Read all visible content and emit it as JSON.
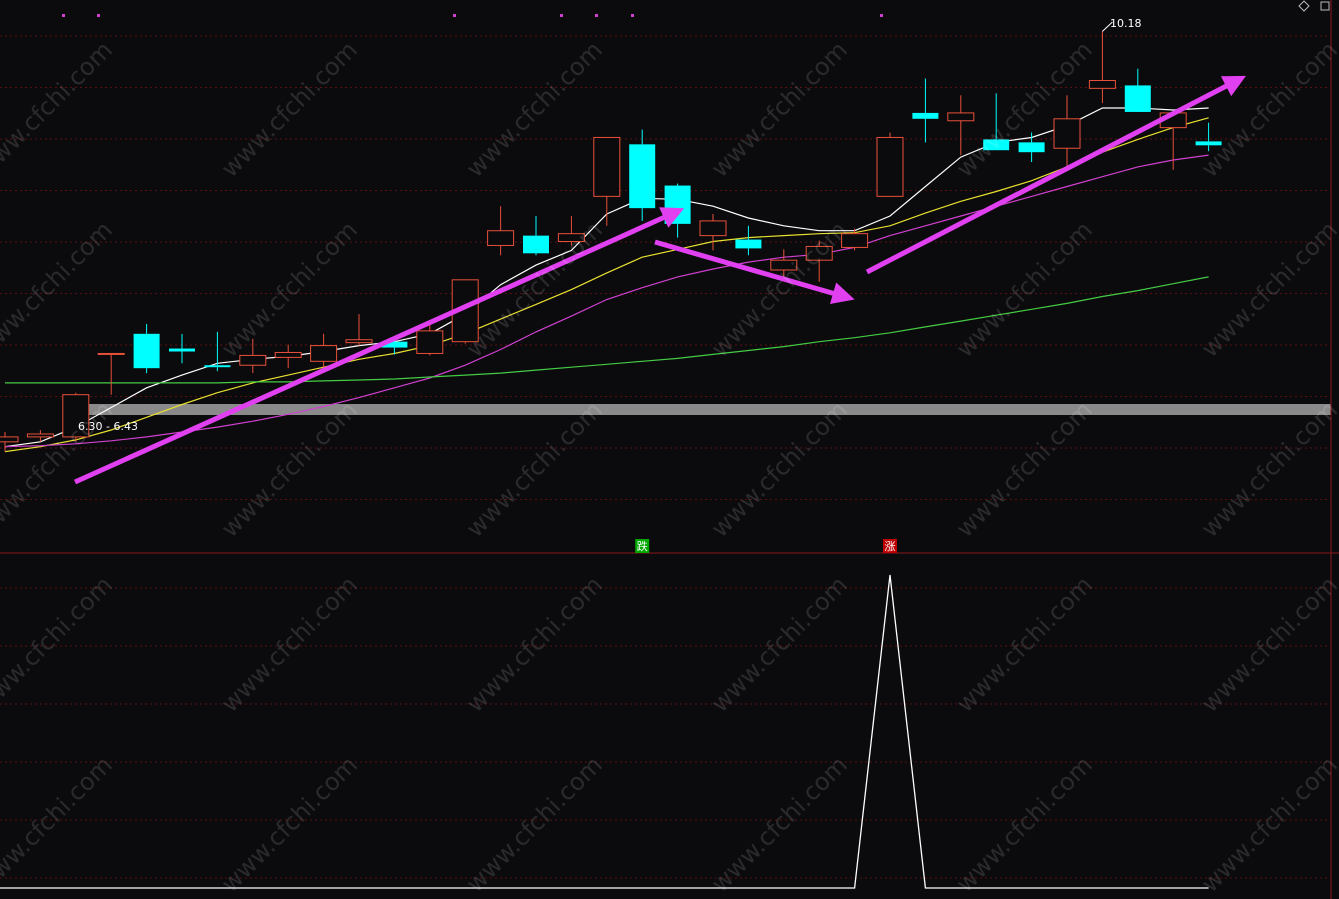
{
  "chart_data": {
    "type": "candlestick",
    "price_range": [
      5.0,
      10.5
    ],
    "candles": [
      {
        "o": 6.0,
        "h": 6.1,
        "l": 5.9,
        "c": 6.05
      },
      {
        "o": 6.05,
        "h": 6.12,
        "l": 6.0,
        "c": 6.08
      },
      {
        "o": 6.05,
        "h": 6.5,
        "l": 6.0,
        "c": 6.48
      },
      {
        "o": 6.9,
        "h": 6.9,
        "l": 6.48,
        "c": 6.9
      },
      {
        "o": 7.1,
        "h": 7.2,
        "l": 6.7,
        "c": 6.75
      },
      {
        "o": 6.95,
        "h": 7.1,
        "l": 6.8,
        "c": 6.92
      },
      {
        "o": 6.78,
        "h": 7.12,
        "l": 6.72,
        "c": 6.76
      },
      {
        "o": 6.78,
        "h": 7.05,
        "l": 6.7,
        "c": 6.88
      },
      {
        "o": 6.86,
        "h": 6.99,
        "l": 6.75,
        "c": 6.91
      },
      {
        "o": 6.82,
        "h": 7.1,
        "l": 6.75,
        "c": 6.98
      },
      {
        "o": 7.01,
        "h": 7.3,
        "l": 6.98,
        "c": 7.04
      },
      {
        "o": 7.02,
        "h": 7.05,
        "l": 6.89,
        "c": 6.96
      },
      {
        "o": 6.9,
        "h": 7.2,
        "l": 6.88,
        "c": 7.13
      },
      {
        "o": 7.02,
        "h": 7.51,
        "l": 7.0,
        "c": 7.65
      },
      {
        "o": 8.0,
        "h": 8.4,
        "l": 7.9,
        "c": 8.15
      },
      {
        "o": 8.1,
        "h": 8.3,
        "l": 7.9,
        "c": 7.92
      },
      {
        "o": 8.04,
        "h": 8.3,
        "l": 8.0,
        "c": 8.12
      },
      {
        "o": 8.5,
        "h": 8.9,
        "l": 8.2,
        "c": 9.1
      },
      {
        "o": 9.03,
        "h": 9.18,
        "l": 8.25,
        "c": 8.38
      },
      {
        "o": 8.61,
        "h": 8.63,
        "l": 8.08,
        "c": 8.22
      },
      {
        "o": 8.1,
        "h": 8.32,
        "l": 7.95,
        "c": 8.25
      },
      {
        "o": 8.06,
        "h": 8.2,
        "l": 7.9,
        "c": 7.97
      },
      {
        "o": 7.75,
        "h": 7.96,
        "l": 7.65,
        "c": 7.85
      },
      {
        "o": 7.85,
        "h": 8.05,
        "l": 7.63,
        "c": 7.99
      },
      {
        "o": 7.98,
        "h": 8.17,
        "l": 7.95,
        "c": 8.12
      },
      {
        "o": 8.5,
        "h": 9.15,
        "l": 8.5,
        "c": 9.1
      },
      {
        "o": 9.35,
        "h": 9.7,
        "l": 9.05,
        "c": 9.29
      },
      {
        "o": 9.27,
        "h": 9.53,
        "l": 8.92,
        "c": 9.35
      },
      {
        "o": 9.08,
        "h": 9.55,
        "l": 8.97,
        "c": 8.97
      },
      {
        "o": 9.05,
        "h": 9.15,
        "l": 8.85,
        "c": 8.95
      },
      {
        "o": 8.99,
        "h": 9.53,
        "l": 8.8,
        "c": 9.29
      },
      {
        "o": 9.6,
        "h": 10.18,
        "l": 9.45,
        "c": 9.68
      },
      {
        "o": 9.63,
        "h": 9.8,
        "l": 9.39,
        "c": 9.36
      },
      {
        "o": 9.2,
        "h": 9.35,
        "l": 8.77,
        "c": 9.35
      },
      {
        "o": 9.06,
        "h": 9.25,
        "l": 8.96,
        "c": 9.02
      }
    ],
    "high_label": "10.18",
    "band_label": "6.30 - 6.43",
    "signals": [
      {
        "label": "跌",
        "candle": 18,
        "color": "#00a800"
      },
      {
        "label": "涨",
        "candle": 25,
        "color": "#c00000"
      }
    ],
    "ma_lines": [
      {
        "color": "#ffffff",
        "values": [
          5.95,
          6.0,
          6.15,
          6.35,
          6.55,
          6.68,
          6.8,
          6.84,
          6.87,
          6.92,
          6.98,
          7.02,
          7.1,
          7.3,
          7.6,
          7.8,
          7.95,
          8.32,
          8.48,
          8.47,
          8.4,
          8.28,
          8.2,
          8.15,
          8.15,
          8.3,
          8.6,
          8.9,
          9.05,
          9.1,
          9.22,
          9.4,
          9.4,
          9.38,
          9.4
        ]
      },
      {
        "color": "#e8e030",
        "values": [
          5.9,
          5.95,
          6.02,
          6.12,
          6.25,
          6.38,
          6.5,
          6.6,
          6.68,
          6.76,
          6.84,
          6.9,
          6.98,
          7.1,
          7.25,
          7.4,
          7.55,
          7.72,
          7.88,
          7.96,
          8.04,
          8.08,
          8.1,
          8.12,
          8.13,
          8.2,
          8.33,
          8.45,
          8.55,
          8.66,
          8.8,
          8.95,
          9.08,
          9.2,
          9.3
        ]
      },
      {
        "color": "#d040d0",
        "values": [
          5.95,
          5.96,
          5.98,
          6.01,
          6.05,
          6.1,
          6.15,
          6.21,
          6.28,
          6.36,
          6.45,
          6.55,
          6.65,
          6.78,
          6.94,
          7.12,
          7.28,
          7.45,
          7.57,
          7.68,
          7.76,
          7.83,
          7.88,
          7.91,
          7.98,
          8.1,
          8.2,
          8.3,
          8.4,
          8.5,
          8.6,
          8.7,
          8.8,
          8.87,
          8.92
        ]
      },
      {
        "color": "#44cc44",
        "values": [
          6.6,
          6.6,
          6.6,
          6.6,
          6.6,
          6.6,
          6.6,
          6.61,
          6.61,
          6.62,
          6.63,
          6.64,
          6.66,
          6.68,
          6.7,
          6.73,
          6.76,
          6.79,
          6.82,
          6.85,
          6.89,
          6.93,
          6.97,
          7.02,
          7.06,
          7.11,
          7.17,
          7.23,
          7.29,
          7.35,
          7.41,
          7.48,
          7.54,
          7.61,
          7.68
        ]
      }
    ],
    "indicator": {
      "type": "line",
      "color": "#ffffff",
      "range": [
        0,
        100
      ],
      "values": [
        0,
        0,
        0,
        0,
        0,
        0,
        0,
        0,
        0,
        0,
        0,
        0,
        0,
        0,
        0,
        0,
        0,
        0,
        0,
        0,
        0,
        0,
        0,
        0,
        0,
        100,
        0,
        0,
        0,
        0,
        0,
        0,
        0,
        0,
        0
      ]
    }
  },
  "watermark": "www.cfchi.com"
}
